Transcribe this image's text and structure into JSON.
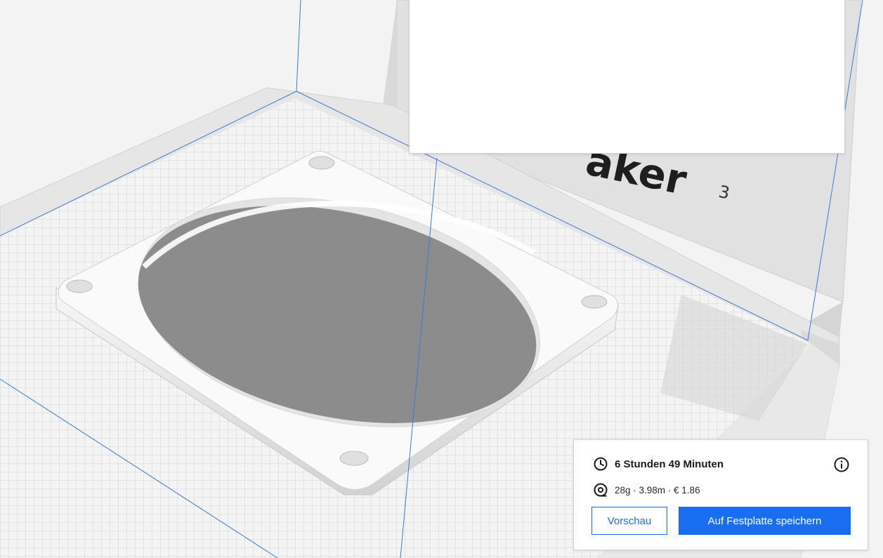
{
  "printer_logo_text": "aker",
  "printer_logo_superscript": "3",
  "print_info": {
    "time": "6 Stunden 49 Minuten",
    "material": "28g · 3.98m · € 1.86"
  },
  "buttons": {
    "preview": "Vorschau",
    "save": "Auf Festplatte speichern"
  },
  "icons": {
    "time": "clock-icon",
    "material": "spool-icon",
    "info": "info-icon"
  },
  "colors": {
    "accent": "#196ef0",
    "build_volume_line": "#3a7bd5"
  }
}
